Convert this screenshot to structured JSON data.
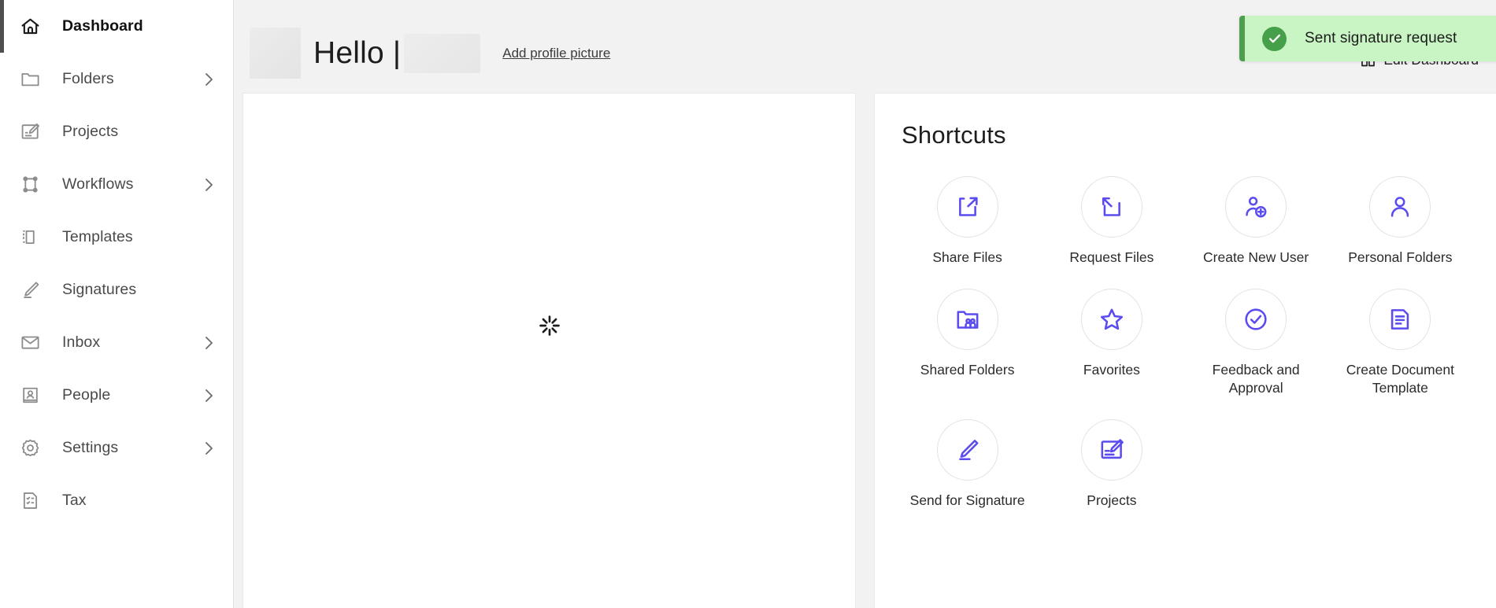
{
  "sidebar": {
    "items": [
      {
        "label": "Dashboard",
        "icon": "home-icon",
        "active": true,
        "chevron": false
      },
      {
        "label": "Folders",
        "icon": "folder-icon",
        "active": false,
        "chevron": true
      },
      {
        "label": "Projects",
        "icon": "projects-icon",
        "active": false,
        "chevron": false
      },
      {
        "label": "Workflows",
        "icon": "workflows-icon",
        "active": false,
        "chevron": true
      },
      {
        "label": "Templates",
        "icon": "templates-icon",
        "active": false,
        "chevron": false
      },
      {
        "label": "Signatures",
        "icon": "signature-icon",
        "active": false,
        "chevron": false
      },
      {
        "label": "Inbox",
        "icon": "envelope-icon",
        "active": false,
        "chevron": true
      },
      {
        "label": "People",
        "icon": "people-icon",
        "active": false,
        "chevron": true
      },
      {
        "label": "Settings",
        "icon": "gear-icon",
        "active": false,
        "chevron": true
      },
      {
        "label": "Tax",
        "icon": "tax-doc-icon",
        "active": false,
        "chevron": false
      }
    ]
  },
  "header": {
    "greeting": "Hello |",
    "user_name_redacted": true,
    "avatar_redacted": true,
    "add_profile_picture_label": "Add profile picture",
    "edit_dashboard_label": "Edit Dashboard",
    "edit_dashboard_icon": "grid-layout-icon"
  },
  "toast": {
    "message": "Sent signature request",
    "icon": "check-circle-icon",
    "type": "success",
    "background_color": "#c9f4c4",
    "accent_color": "#4d9f4f",
    "icon_color": "#46a049"
  },
  "content_panel": {
    "state": "loading",
    "spinner_icon": "loading-spinner-icon"
  },
  "shortcuts": {
    "title": "Shortcuts",
    "accent_color": "#5b4cf0",
    "items": [
      {
        "label": "Share Files",
        "icon": "share-files-icon"
      },
      {
        "label": "Request Files",
        "icon": "request-files-icon"
      },
      {
        "label": "Create New User",
        "icon": "user-add-icon"
      },
      {
        "label": "Personal Folders",
        "icon": "person-icon"
      },
      {
        "label": "Shared Folders",
        "icon": "shared-folder-icon"
      },
      {
        "label": "Favorites",
        "icon": "star-icon"
      },
      {
        "label": "Feedback and Approval",
        "icon": "check-circle-outline-icon"
      },
      {
        "label": "Create Document Template",
        "icon": "document-lines-icon"
      },
      {
        "label": "Send for Signature",
        "icon": "signature-pen-icon"
      },
      {
        "label": "Projects",
        "icon": "projects-board-icon"
      }
    ]
  }
}
